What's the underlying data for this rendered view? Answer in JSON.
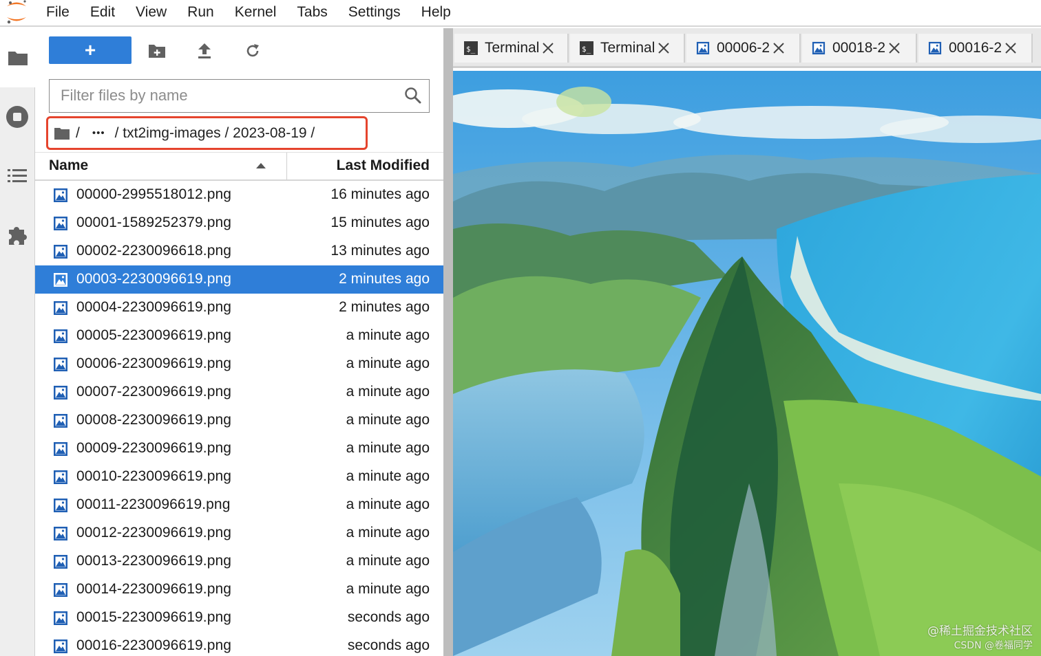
{
  "menubar": {
    "items": [
      "File",
      "Edit",
      "View",
      "Run",
      "Kernel",
      "Tabs",
      "Settings",
      "Help"
    ]
  },
  "activitybar": {
    "icons": [
      "folder-icon",
      "stop-circle-icon",
      "list-icon",
      "puzzle-icon"
    ]
  },
  "filebrowser": {
    "new_label": "+",
    "filter_placeholder": "Filter files by name",
    "breadcrumb": {
      "root": "/",
      "ellipsis": "•••",
      "path": "/ txt2img-images / 2023-08-19 /"
    },
    "header": {
      "name": "Name",
      "modified": "Last Modified"
    },
    "files": [
      {
        "name": "00000-2995518012.png",
        "modified": "16 minutes ago"
      },
      {
        "name": "00001-1589252379.png",
        "modified": "15 minutes ago"
      },
      {
        "name": "00002-2230096618.png",
        "modified": "13 minutes ago"
      },
      {
        "name": "00003-2230096619.png",
        "modified": "2 minutes ago",
        "selected": true
      },
      {
        "name": "00004-2230096619.png",
        "modified": "2 minutes ago"
      },
      {
        "name": "00005-2230096619.png",
        "modified": "a minute ago"
      },
      {
        "name": "00006-2230096619.png",
        "modified": "a minute ago"
      },
      {
        "name": "00007-2230096619.png",
        "modified": "a minute ago"
      },
      {
        "name": "00008-2230096619.png",
        "modified": "a minute ago"
      },
      {
        "name": "00009-2230096619.png",
        "modified": "a minute ago"
      },
      {
        "name": "00010-2230096619.png",
        "modified": "a minute ago"
      },
      {
        "name": "00011-2230096619.png",
        "modified": "a minute ago"
      },
      {
        "name": "00012-2230096619.png",
        "modified": "a minute ago"
      },
      {
        "name": "00013-2230096619.png",
        "modified": "a minute ago"
      },
      {
        "name": "00014-2230096619.png",
        "modified": "a minute ago"
      },
      {
        "name": "00015-2230096619.png",
        "modified": "seconds ago"
      },
      {
        "name": "00016-2230096619.png",
        "modified": "seconds ago"
      }
    ]
  },
  "tabs": [
    {
      "label": "Terminal",
      "icon": "terminal-icon"
    },
    {
      "label": "Terminal",
      "icon": "terminal-icon"
    },
    {
      "label": "00006-2",
      "icon": "image-file-icon"
    },
    {
      "label": "00018-2",
      "icon": "image-file-icon"
    },
    {
      "label": "00016-2",
      "icon": "image-file-icon"
    }
  ],
  "watermark": {
    "line1": "@稀土掘金技术社区",
    "line2": "CSDN @卷福同学"
  },
  "colors": {
    "accent": "#2f7ed8",
    "breadcrumb_highlight": "#e5442d",
    "logo_orange": "#f37726"
  }
}
